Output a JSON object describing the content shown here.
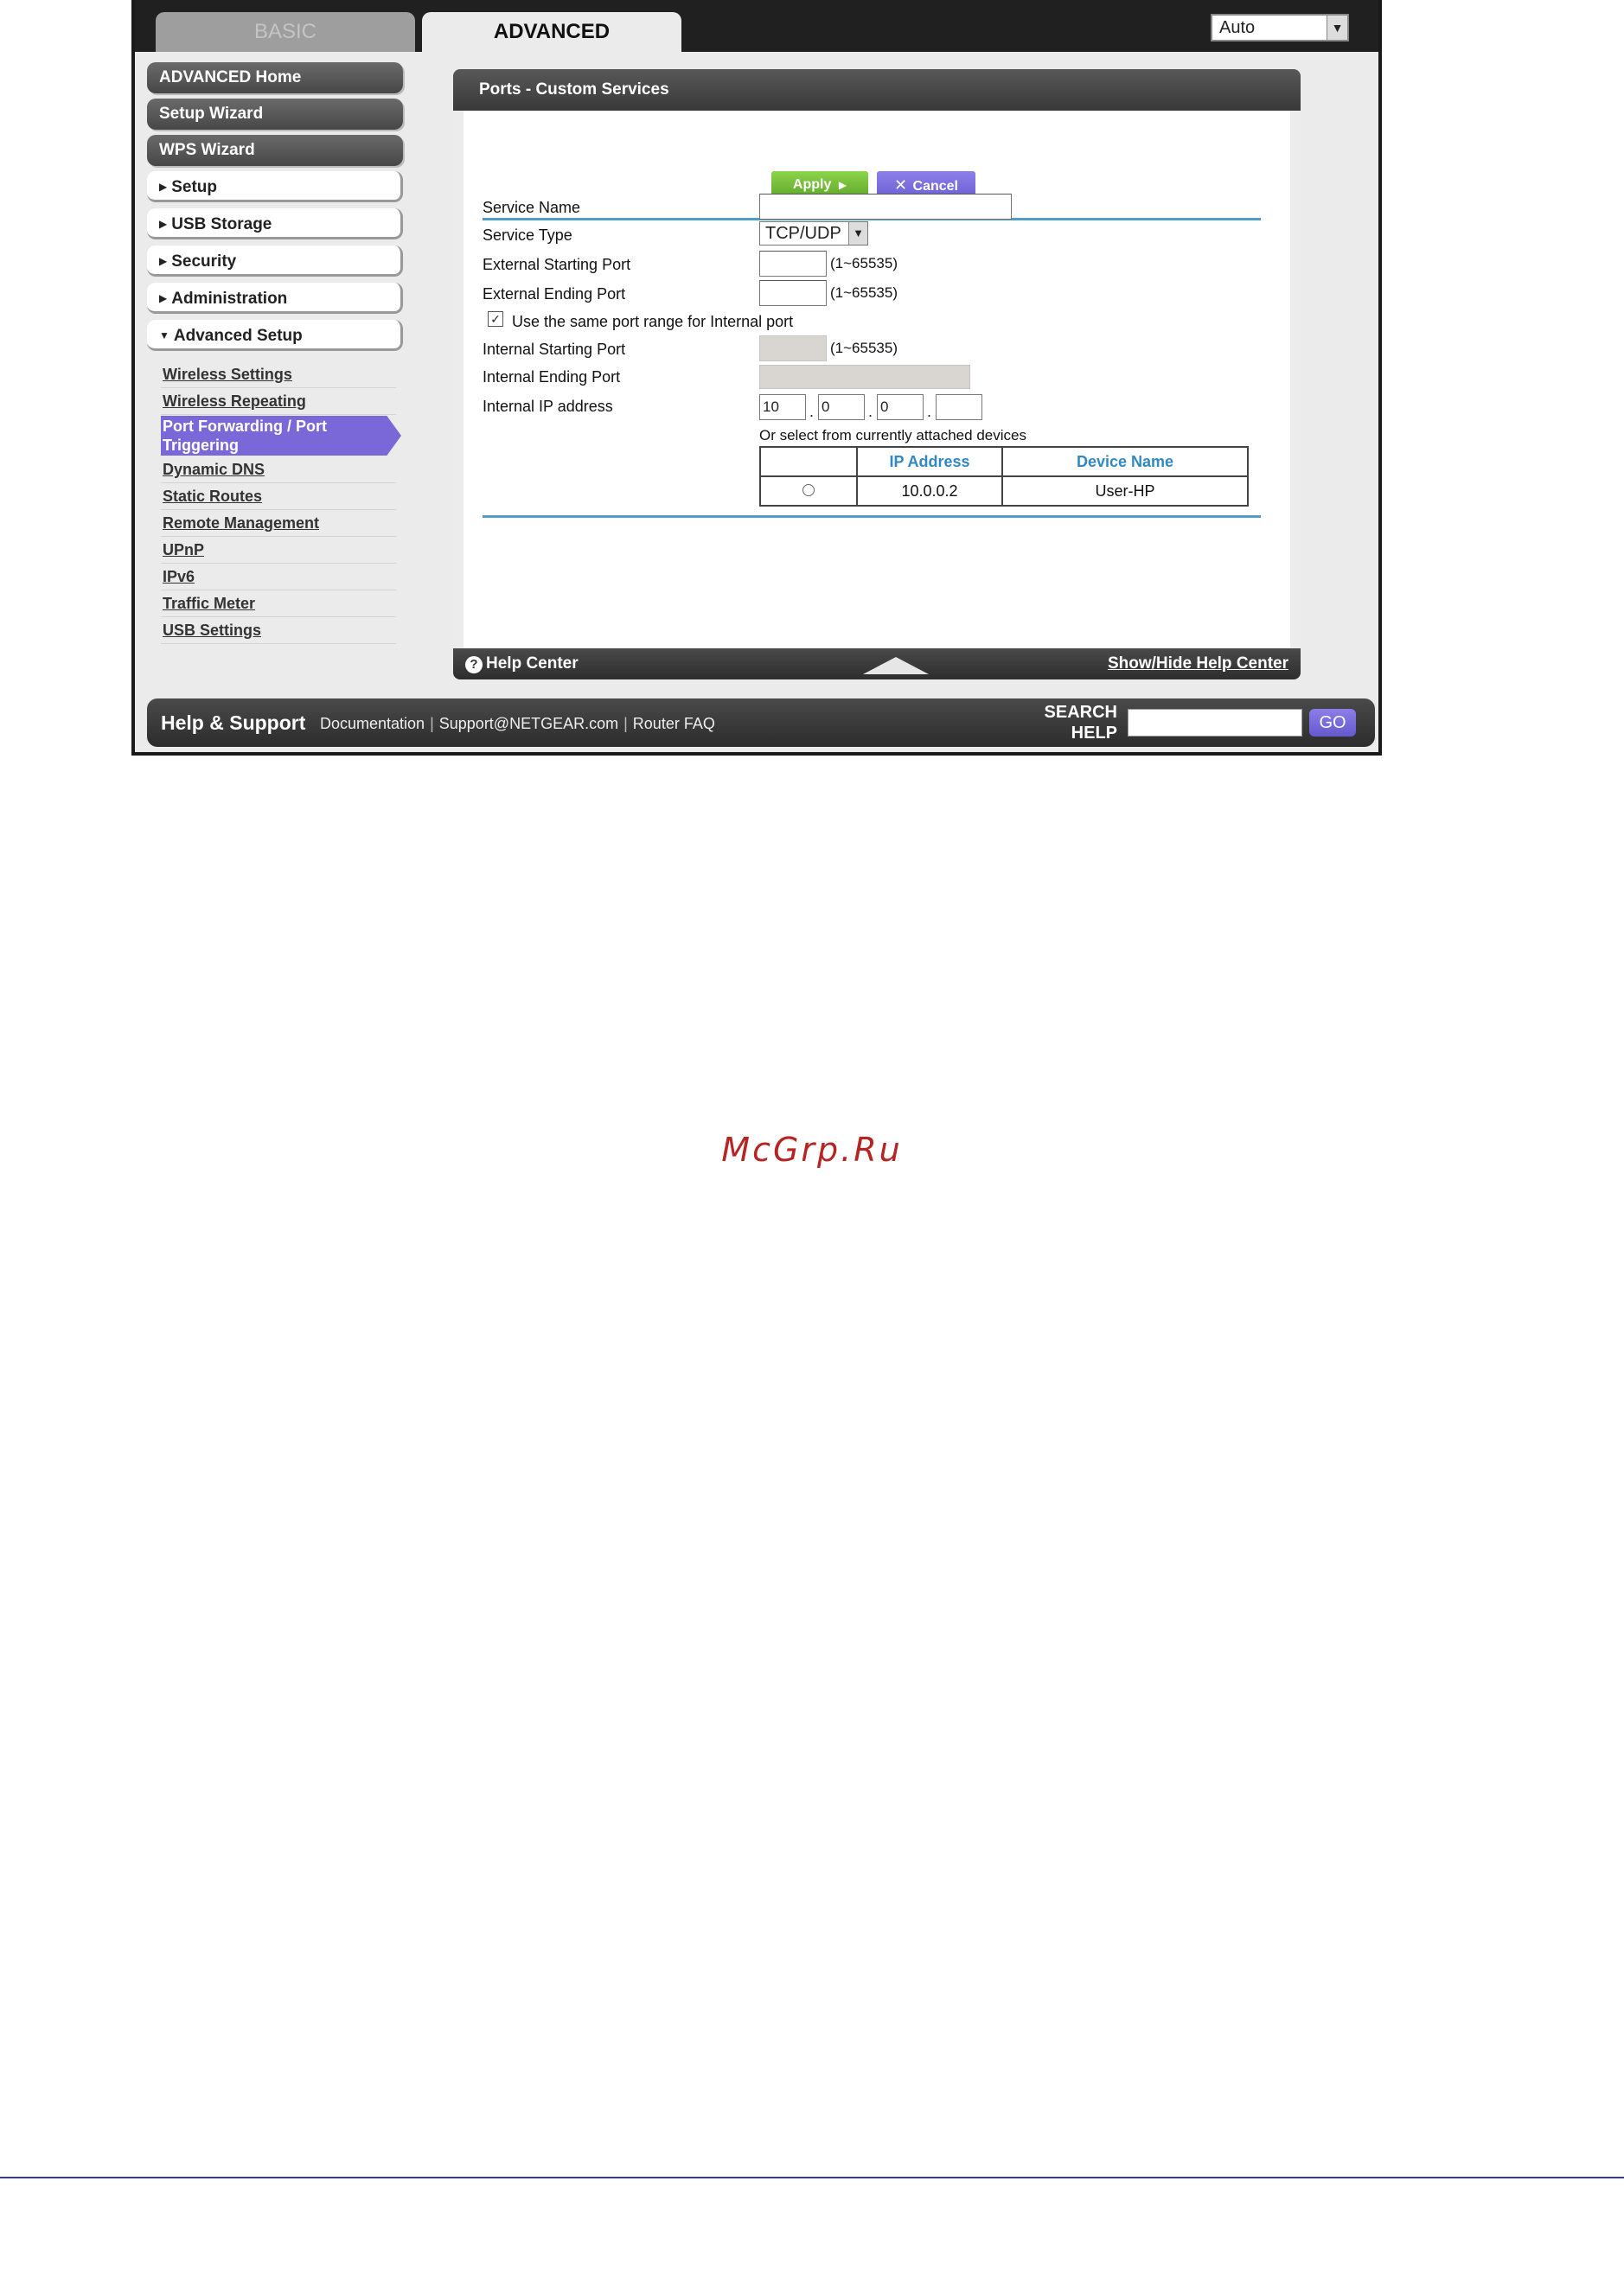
{
  "tabs": {
    "basic": "BASIC",
    "advanced": "ADVANCED"
  },
  "language": {
    "selected": "Auto"
  },
  "sidebar": {
    "top_buttons": [
      "ADVANCED Home",
      "Setup Wizard",
      "WPS Wizard"
    ],
    "sections": [
      "Setup",
      "USB Storage",
      "Security",
      "Administration"
    ],
    "expanded_section": "Advanced Setup",
    "sub_items": [
      "Wireless Settings",
      "Wireless Repeating",
      "Port Forwarding / Port Triggering",
      "Dynamic DNS",
      "Static Routes",
      "Remote Management",
      "UPnP",
      "IPv6",
      "Traffic Meter",
      "USB Settings"
    ],
    "active_sub_item_line1": "Port Forwarding / Port",
    "active_sub_item_line2": "Triggering"
  },
  "panel": {
    "title": "Ports - Custom Services",
    "apply_label": "Apply",
    "cancel_label": "Cancel",
    "form": {
      "service_name_label": "Service Name",
      "service_name_value": "",
      "service_type_label": "Service Type",
      "service_type_value": "TCP/UDP",
      "ext_start_label": "External Starting Port",
      "ext_end_label": "External Ending Port",
      "port_range_hint": "(1~65535)",
      "same_range_label": "Use the same port range for Internal port",
      "same_range_checked": true,
      "int_start_label": "Internal Starting Port",
      "int_end_label": "Internal Ending Port",
      "ip_label": "Internal IP address",
      "ip_octets": [
        "10",
        "0",
        "0",
        ""
      ],
      "select_devices_label": "Or select from currently attached devices"
    },
    "devices_table": {
      "columns": [
        "",
        "IP Address",
        "Device Name"
      ],
      "rows": [
        {
          "ip": "10.0.0.2",
          "name": "User-HP"
        }
      ]
    },
    "footer": {
      "help_center": "Help Center",
      "show_hide": "Show/Hide Help Center"
    }
  },
  "help_bar": {
    "title": "Help & Support",
    "links": [
      "Documentation",
      "Support@NETGEAR.com",
      "Router FAQ"
    ],
    "search_line1": "SEARCH",
    "search_line2": "HELP",
    "go_label": "GO"
  },
  "watermark": "McGrp.Ru",
  "colors": {
    "apply_green": "#6cb932",
    "cancel_purple": "#7a6ede",
    "active_menu": "#7b68d8",
    "table_header_blue": "#3189c3",
    "rule_blue": "#4f9ec6",
    "watermark_red": "#b52524"
  },
  "icons": {
    "help": "question-circle-icon",
    "apply": "play-arrow-icon",
    "cancel": "x-icon",
    "collapse": "triangle-up-icon",
    "dropdown": "chevron-down-icon"
  }
}
